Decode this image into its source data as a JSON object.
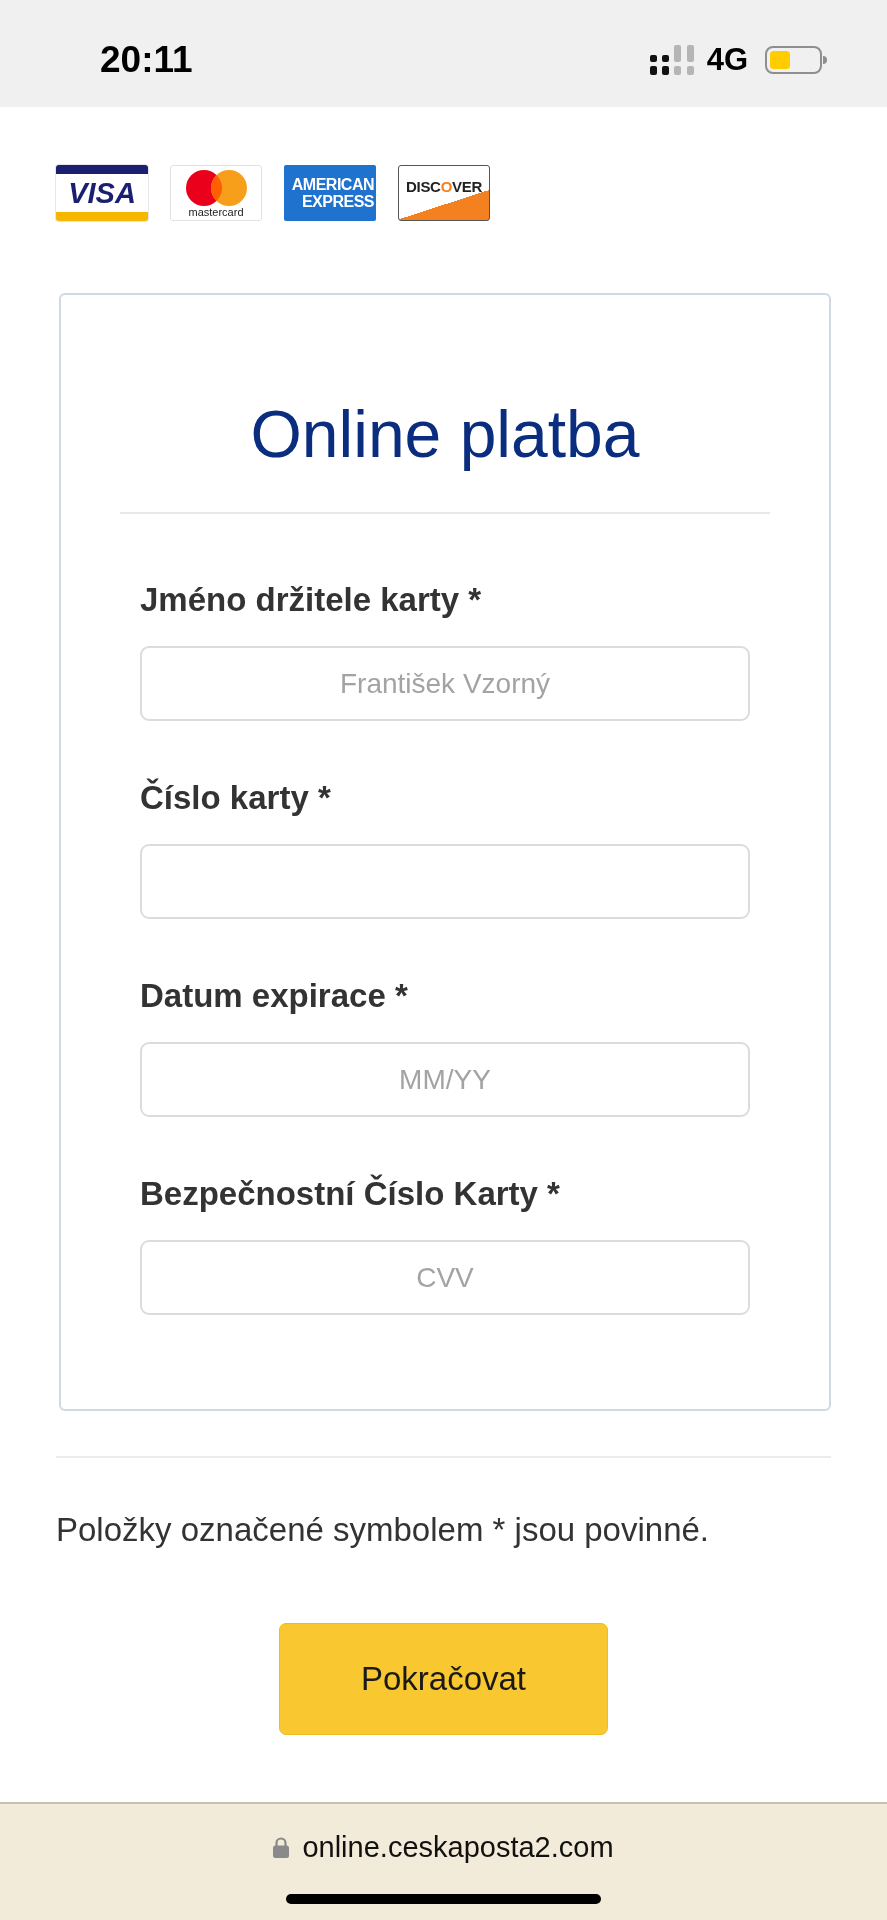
{
  "status_bar": {
    "time": "20:11",
    "network": "4G"
  },
  "card_logos": [
    {
      "kind": "visa",
      "text": "VISA"
    },
    {
      "kind": "mastercard",
      "text": "mastercard"
    },
    {
      "kind": "amex",
      "text": "AMERICAN EXPRESS"
    },
    {
      "kind": "discover",
      "parts": [
        {
          "text": "DISC",
          "accent": false
        },
        {
          "text": "O",
          "accent": true
        },
        {
          "text": "VER",
          "accent": false
        }
      ]
    }
  ],
  "form": {
    "title": "Online platba",
    "fields": [
      {
        "label": "Jméno držitele karty *",
        "placeholder": "František Vzorný"
      },
      {
        "label": "Číslo karty *"
      },
      {
        "label": "Datum expirace *",
        "placeholder": "MM/YY"
      },
      {
        "label": "Bezpečnostní Číslo Karty *",
        "placeholder": "CVV"
      }
    ]
  },
  "required_note": "Položky označené symbolem * jsou povinné.",
  "continue_button": "Pokračovat",
  "address_bar": {
    "url": "online.ceskaposta2.com"
  }
}
